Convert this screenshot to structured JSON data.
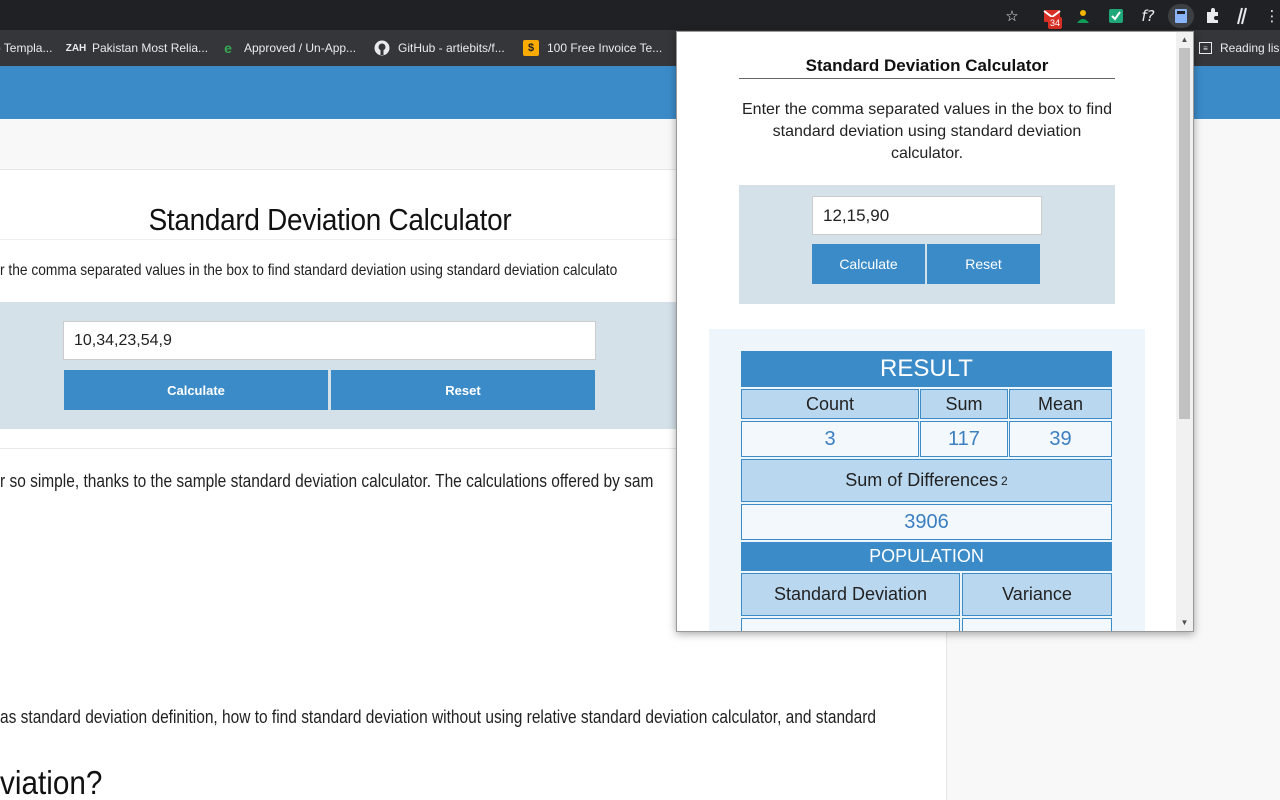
{
  "browser": {
    "gmail_badge": "34",
    "reading_list": "Reading lis",
    "bookmarks": [
      {
        "label": "p Templa...",
        "icon": ""
      },
      {
        "label": "Pakistan Most Relia...",
        "icon": "ZAH"
      },
      {
        "label": "Approved / Un-App...",
        "icon": "e"
      },
      {
        "label": "GitHub - artiebits/f...",
        "icon": "github-icon"
      },
      {
        "label": "100 Free Invoice Te...",
        "icon": "$"
      }
    ]
  },
  "page": {
    "title": "Standard Deviation Calculator",
    "description": "r the comma separated values in the box to find standard deviation using standard deviation calculato",
    "input_value": "10,34,23,54,9",
    "calculate_label": "Calculate",
    "reset_label": "Reset",
    "paragraph1": "r so simple, thanks to the sample standard deviation calculator. The calculations offered by sam",
    "paragraph2": "as standard deviation definition, how to find standard deviation without using relative standard deviation calculator, and standard",
    "heading": "viation?"
  },
  "popup": {
    "title": "Standard Deviation Calculator",
    "description": "Enter the comma separated values in the box to find standard deviation using standard deviation calculator.",
    "input_value": "12,15,90",
    "calculate_label": "Calculate",
    "reset_label": "Reset",
    "result": {
      "header": "RESULT",
      "count_label": "Count",
      "sum_label": "Sum",
      "mean_label": "Mean",
      "count": "3",
      "sum": "117",
      "mean": "39",
      "sum_diff_label": "Sum of Differences",
      "sum_diff_sup": "2",
      "sum_diff": "3906",
      "population_label": "POPULATION",
      "sd_label": "Standard Deviation",
      "variance_label": "Variance"
    }
  }
}
